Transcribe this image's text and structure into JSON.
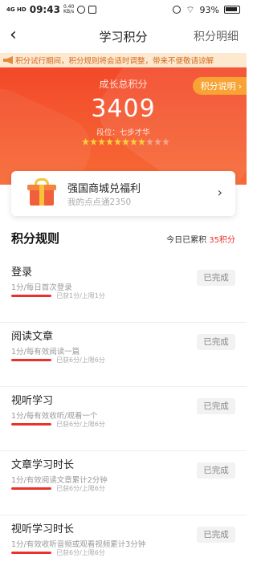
{
  "status_bar": {
    "signal": "4G HD",
    "time": "09:43",
    "speed_value": "0.40",
    "speed_unit": "KB/s",
    "battery": "93%"
  },
  "nav": {
    "back_icon": "back-chevron-icon",
    "title": "学习积分",
    "detail_link": "积分明细"
  },
  "notice": {
    "icon": "megaphone-icon",
    "text": "积分试行期间，积分规则将会适时调整，带来不便敬请谅解"
  },
  "hero": {
    "label": "成长总积分",
    "score": "3409",
    "rank_label": "段位：",
    "rank_value": "七步才华",
    "stars": {
      "filled": 8,
      "total": 11
    },
    "explain_button": "积分说明",
    "explain_icon": "chevron-right-icon",
    "colors": {
      "primary": "#f2492a",
      "accent": "#f8a434"
    }
  },
  "mall_card": {
    "icon": "gift-icon",
    "title": "强国商城兑福利",
    "subtitle": "我的点点通2350",
    "arrow_icon": "chevron-right-icon"
  },
  "rules": {
    "heading": "积分规则",
    "today_prefix": "今日已累积",
    "today_value": "35积分",
    "items": [
      {
        "name": "登录",
        "desc": "1分/每日首次登录",
        "progress_text": "已获1分/上限1分",
        "progress": 1.0,
        "button": "已完成"
      },
      {
        "name": "阅读文章",
        "desc": "1分/每有效阅读一篇",
        "progress_text": "已获6分/上限6分",
        "progress": 1.0,
        "button": "已完成"
      },
      {
        "name": "视听学习",
        "desc": "1分/每有效收听/观看一个",
        "progress_text": "已获6分/上限6分",
        "progress": 1.0,
        "button": "已完成"
      },
      {
        "name": "文章学习时长",
        "desc": "1分/有效阅读文章累计2分钟",
        "progress_text": "已获6分/上限6分",
        "progress": 1.0,
        "button": "已完成"
      },
      {
        "name": "视听学习时长",
        "desc": "1分/有效收听音频或观看视频累计3分钟",
        "progress_text": "已获6分/上限6分",
        "progress": 1.0,
        "button": "已完成"
      }
    ]
  }
}
